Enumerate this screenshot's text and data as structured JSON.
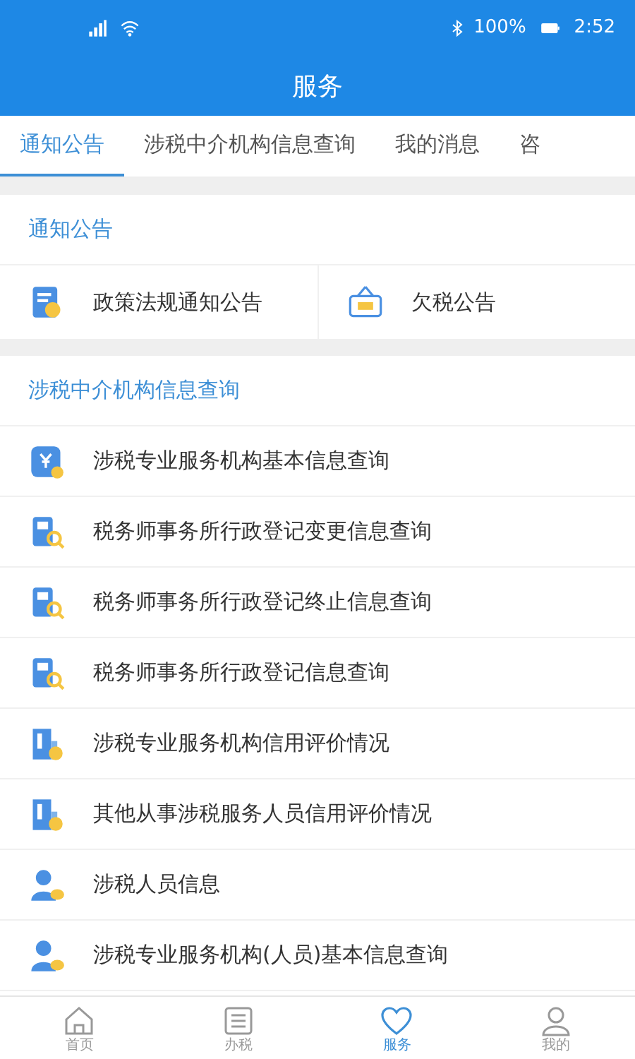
{
  "status_bar": {
    "battery": "100%",
    "time": "2:52"
  },
  "header": {
    "title": "服务"
  },
  "tabs": [
    {
      "label": "通知公告",
      "selected": true
    },
    {
      "label": "涉税中介机构信息查询",
      "selected": false
    },
    {
      "label": "我的消息",
      "selected": false
    },
    {
      "label": "咨",
      "selected": false
    }
  ],
  "sections": [
    {
      "title": "通知公告",
      "kind": "grid",
      "items": [
        {
          "label": "政策法规通知公告",
          "kind": "document"
        },
        {
          "label": "欠税公告",
          "kind": "sign"
        }
      ]
    },
    {
      "title": "涉税中介机构信息查询",
      "kind": "list",
      "items": [
        {
          "label": "涉税专业服务机构基本信息查询",
          "kind": "yuan"
        },
        {
          "label": "税务师事务所行政登记变更信息查询",
          "kind": "search"
        },
        {
          "label": "税务师事务所行政登记终止信息查询",
          "kind": "search"
        },
        {
          "label": "税务师事务所行政登记信息查询",
          "kind": "search"
        },
        {
          "label": "涉税专业服务机构信用评价情况",
          "kind": "building"
        },
        {
          "label": "其他从事涉税服务人员信用评价情况",
          "kind": "building"
        },
        {
          "label": "涉税人员信息",
          "kind": "person"
        },
        {
          "label": "涉税专业服务机构(人员)基本信息查询",
          "kind": "person"
        }
      ]
    }
  ],
  "bottom_nav": [
    {
      "label": "首页",
      "kind": "home",
      "selected": false
    },
    {
      "label": "办税",
      "kind": "list",
      "selected": false
    },
    {
      "label": "服务",
      "kind": "heart",
      "selected": true
    },
    {
      "label": "我的",
      "kind": "user",
      "selected": false
    }
  ]
}
